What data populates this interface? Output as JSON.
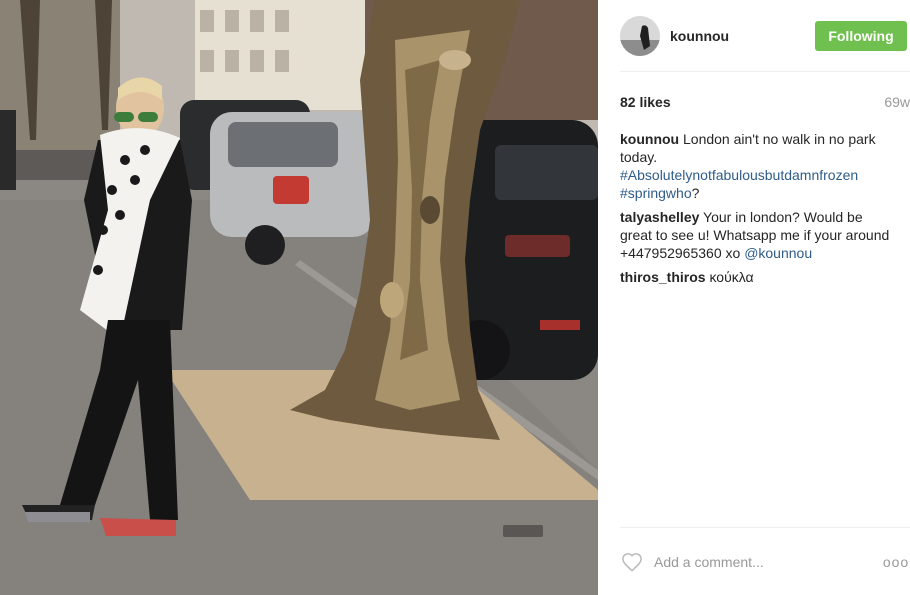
{
  "post": {
    "image_alt": "Woman in sunglasses and scarf standing by a large tree on a London street",
    "author": "kounnou",
    "follow_label": "Following",
    "likes": "82 likes",
    "time_ago": "69w"
  },
  "comments": [
    {
      "user": "kounnou",
      "text_before": "London ain't no walk in no park today.",
      "tag1": "#Absolutelynotfabulousbutdamnfrozen",
      "tag2": "#springwho",
      "text_after": "?"
    },
    {
      "user": "talyashelley",
      "text_before": "Your in london? Would be great to see u! Whatsapp me if your around +447952965360 xo",
      "mention": "@kounnou"
    },
    {
      "user": "thiros_thiros",
      "text_before": "κούκλα"
    }
  ],
  "footer": {
    "comment_placeholder": "Add a comment...",
    "more_label": "ooo"
  },
  "icons": {
    "heart": "heart-outline-icon",
    "more": "more-options-icon"
  },
  "colors": {
    "follow_button": "#70c050",
    "link": "#2f5c8a",
    "muted": "#999999"
  }
}
